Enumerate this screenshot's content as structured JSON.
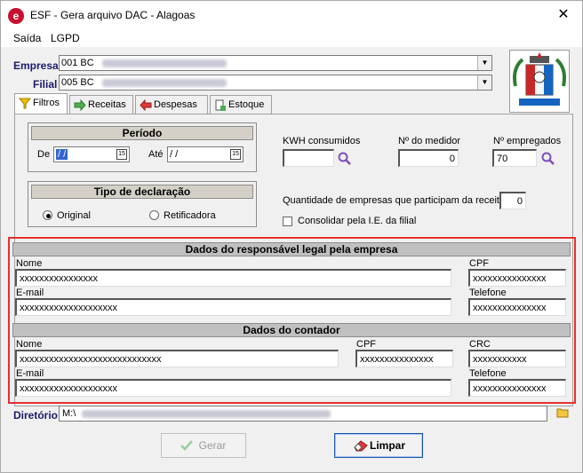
{
  "window": {
    "title": "ESF - Gera arquivo DAC - Alagoas",
    "app_icon": "esf-logo-icon",
    "close": "✕"
  },
  "menu": [
    "Saída",
    "LGPD"
  ],
  "empresa": {
    "label": "Empresa",
    "value": "001 BC"
  },
  "filial": {
    "label": "Filial",
    "value": "005 BC"
  },
  "tabs": [
    {
      "label": "Filtros",
      "icon": "funnel-icon",
      "active": true
    },
    {
      "label": "Receitas",
      "icon": "arrow-right-icon",
      "active": false
    },
    {
      "label": "Despesas",
      "icon": "arrow-left-icon",
      "active": false
    },
    {
      "label": "Estoque",
      "icon": "document-add-icon",
      "active": false
    }
  ],
  "periodo": {
    "title": "Período",
    "de_label": "De",
    "de_value": " / /",
    "ate_label": "Até",
    "ate_value": " / /"
  },
  "tipo": {
    "title": "Tipo de declaração",
    "options": [
      {
        "label": "Original",
        "selected": true
      },
      {
        "label": "Retificadora",
        "selected": false
      }
    ]
  },
  "kwh": {
    "label": "KWH consumidos",
    "value": ""
  },
  "medidor": {
    "label": "Nº do medidor",
    "value": "0"
  },
  "empregados": {
    "label": "Nº empregados",
    "value": "70"
  },
  "quantidade": {
    "label": "Quantidade de empresas que participam da receita",
    "value": "0"
  },
  "consolidar": {
    "label": "Consolidar pela I.E. da filial",
    "checked": false
  },
  "responsavel": {
    "title": "Dados do responsável legal pela empresa",
    "nome_label": "Nome",
    "nome_value": "xxxxxxxxxxxxxxxx",
    "cpf_label": "CPF",
    "cpf_value": "xxxxxxxxxxxxxxx",
    "email_label": "E-mail",
    "email_value": "xxxxxxxxxxxxxxxxxxxx",
    "telefone_label": "Telefone",
    "telefone_value": "xxxxxxxxxxxxxxx"
  },
  "contador": {
    "title": "Dados do contador",
    "nome_label": "Nome",
    "nome_value": "xxxxxxxxxxxxxxxxxxxxxxxxxxxxx",
    "cpf_label": "CPF",
    "cpf_value": "xxxxxxxxxxxxxxx",
    "crc_label": "CRC",
    "crc_value": "xxxxxxxxxxx",
    "email_label": "E-mail",
    "email_value": "xxxxxxxxxxxxxxxxxxxx",
    "telefone_label": "Telefone",
    "telefone_value": "xxxxxxxxxxxxxxx"
  },
  "diretorio": {
    "label": "Diretório",
    "value": "M:\\"
  },
  "buttons": {
    "gerar": "Gerar",
    "limpar": "Limpar"
  },
  "colors": {
    "highlight": "#e53030",
    "accent": "#1a55a8"
  }
}
